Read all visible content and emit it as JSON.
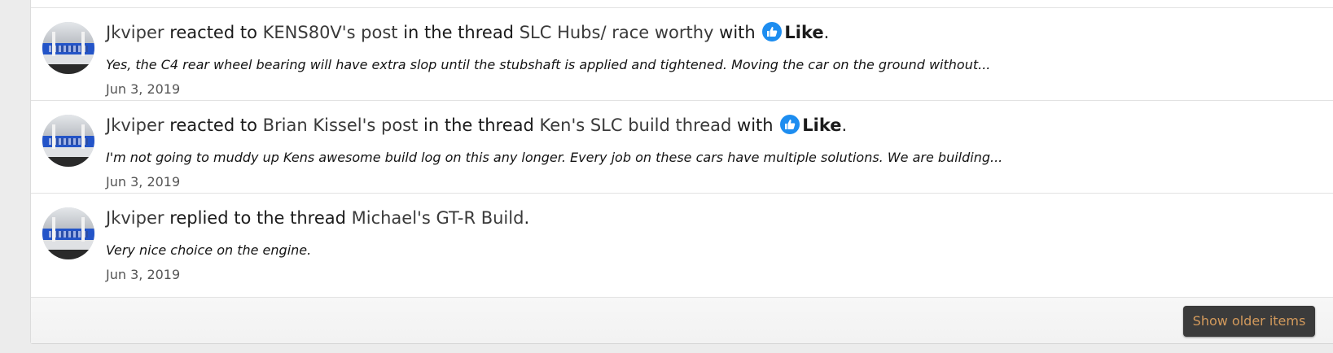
{
  "feed": {
    "items": [
      {
        "user": "Jkviper",
        "verb": " reacted to ",
        "target": "KENS80V's post",
        "thread_prefix": " in the thread ",
        "thread": "SLC Hubs/ race worthy",
        "with_text": " with ",
        "reaction": "Like",
        "end": ".",
        "snippet": "Yes, the C4 rear wheel bearing will have extra slop until the stubshaft is applied and tightened. Moving the car on the ground without...",
        "date": "Jun 3, 2019"
      },
      {
        "user": "Jkviper",
        "verb": " reacted to ",
        "target": "Brian Kissel's post",
        "thread_prefix": " in the thread ",
        "thread": "Ken's SLC build thread",
        "with_text": " with ",
        "reaction": "Like",
        "end": ".",
        "snippet": "I'm not going to muddy up Kens awesome build log on this any longer. Every job on these cars have multiple solutions. We are building...",
        "date": "Jun 3, 2019"
      },
      {
        "user": "Jkviper",
        "verb": " replied to the thread ",
        "thread": "Michael's GT-R Build",
        "end": ".",
        "snippet": "Very nice choice on the engine.",
        "date": "Jun 3, 2019"
      }
    ]
  },
  "footer": {
    "show_older_label": "Show older items"
  },
  "icons": {
    "like_icon": "thumbs-up-icon",
    "like_color": "#1d8df0"
  },
  "colors": {
    "button_bg": "#3b3b3b",
    "button_text": "#d39a5c"
  }
}
